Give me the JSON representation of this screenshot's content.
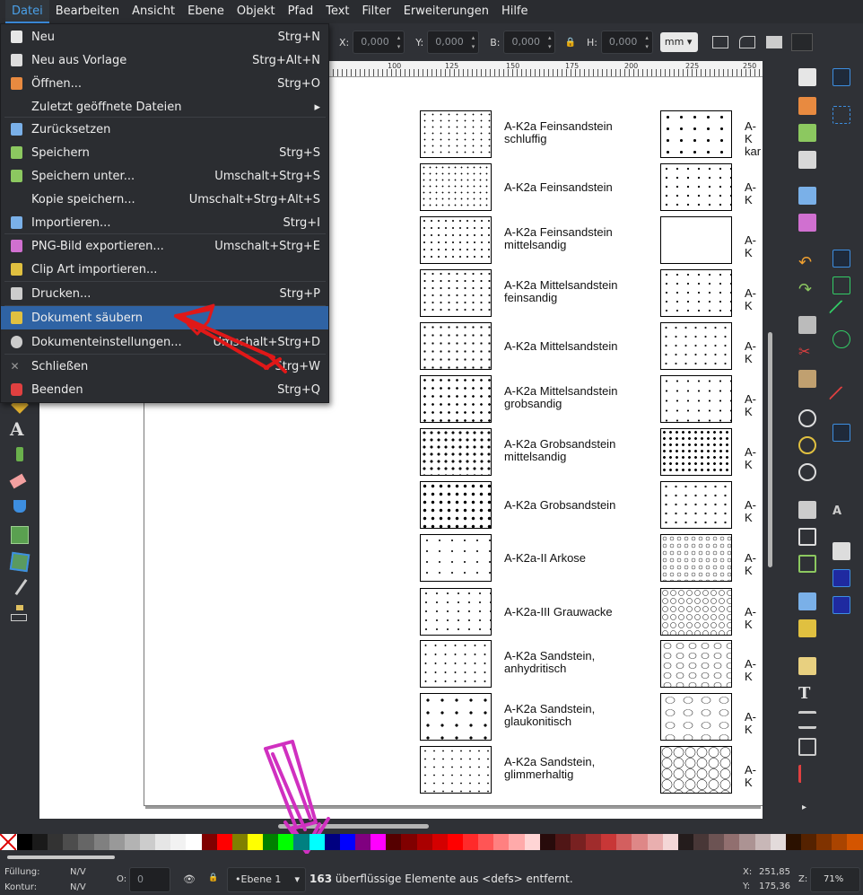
{
  "menubar": {
    "items": [
      "Datei",
      "Bearbeiten",
      "Ansicht",
      "Ebene",
      "Objekt",
      "Pfad",
      "Text",
      "Filter",
      "Erweiterungen",
      "Hilfe"
    ]
  },
  "toolbar": {
    "x_label": "X:",
    "x_value": "0,000",
    "y_label": "Y:",
    "y_value": "0,000",
    "w_label": "B:",
    "w_value": "0,000",
    "h_label": "H:",
    "h_value": "0,000",
    "unit": "mm"
  },
  "ruler": {
    "labels": [
      "100",
      "125",
      "150",
      "175",
      "200",
      "225",
      "250"
    ]
  },
  "file_menu": {
    "items": [
      {
        "label": "Neu",
        "shortcut": "Strg+N",
        "icon": "new-doc-icon"
      },
      {
        "label": "Neu aus Vorlage",
        "shortcut": "Strg+Alt+N",
        "icon": "template-icon"
      },
      {
        "label": "Öffnen...",
        "shortcut": "Strg+O",
        "icon": "open-folder-icon"
      },
      {
        "label": "Zuletzt geöffnete Dateien",
        "shortcut": "",
        "icon": "",
        "submenu": "▸"
      },
      {
        "label": "Zurücksetzen",
        "shortcut": "",
        "icon": "revert-icon"
      },
      {
        "label": "Speichern",
        "shortcut": "Strg+S",
        "icon": "save-icon"
      },
      {
        "label": "Speichern unter...",
        "shortcut": "Umschalt+Strg+S",
        "icon": "save-as-icon"
      },
      {
        "label": "Kopie speichern...",
        "shortcut": "Umschalt+Strg+Alt+S",
        "icon": ""
      },
      {
        "label": "Importieren...",
        "shortcut": "Strg+I",
        "icon": "import-icon"
      },
      {
        "label": "PNG-Bild exportieren...",
        "shortcut": "Umschalt+Strg+E",
        "icon": "export-png-icon"
      },
      {
        "label": "Clip Art importieren...",
        "shortcut": "",
        "icon": "clipart-icon"
      },
      {
        "label": "Drucken...",
        "shortcut": "Strg+P",
        "icon": "print-icon"
      },
      {
        "label": "Dokument säubern",
        "shortcut": "",
        "icon": "cleanup-icon",
        "selected": true
      },
      {
        "label": "Dokumenteinstellungen...",
        "shortcut": "Umschalt+Strg+D",
        "icon": "gear-icon"
      },
      {
        "label": "Schließen",
        "shortcut": "Strg+W",
        "icon": "close-icon"
      },
      {
        "label": "Beenden",
        "shortcut": "Strg+Q",
        "icon": "quit-icon"
      }
    ]
  },
  "patterns_left": [
    {
      "label": "A-K2a Feinsandstein\nschluffig"
    },
    {
      "label": "A-K2a Feinsandstein"
    },
    {
      "label": "A-K2a Feinsandstein\nmittelsandig"
    },
    {
      "label": "A-K2a Mittelsandstein\nfeinsandig"
    },
    {
      "label": "A-K2a Mittelsandstein"
    },
    {
      "label": "A-K2a Mittelsandstein\ngrobsandig"
    },
    {
      "label": "A-K2a Grobsandstein\nmittelsandig"
    },
    {
      "label": "A-K2a Grobsandstein"
    },
    {
      "label": "A-K2a-II Arkose"
    },
    {
      "label": "A-K2a-III Grauwacke"
    },
    {
      "label": "A-K2a Sandstein,\nanhydritisch"
    },
    {
      "label": "A-K2a Sandstein,\nglaukonitisch"
    },
    {
      "label": "A-K2a Sandstein,\nglimmerhaltig"
    }
  ],
  "patterns_right": [
    {
      "label": "A-K\nkar"
    },
    {
      "label": "A-K"
    },
    {
      "label": "A-K"
    },
    {
      "label": "A-K"
    },
    {
      "label": "A-K"
    },
    {
      "label": "A-K"
    },
    {
      "label": "A-K"
    },
    {
      "label": "A-K"
    },
    {
      "label": "A-K"
    },
    {
      "label": "A-K"
    },
    {
      "label": "A-K"
    },
    {
      "label": "A-K"
    },
    {
      "label": "A-K"
    }
  ],
  "status": {
    "fill_label": "Füllung:",
    "fill_value": "N/V",
    "stroke_label": "Kontur:",
    "stroke_value": "N/V",
    "opacity_label": "O:",
    "opacity_value": "0",
    "layer": "•Ebene 1",
    "message_count": "163",
    "message": " überflüssige Elemente aus <defs> entfernt.",
    "x_label": "X:",
    "x_value": "251,85",
    "y_label": "Y:",
    "y_value": "175,36",
    "zoom_label": "Z:",
    "zoom_value": "71%"
  },
  "palette_colors": [
    "#000000",
    "#1a1a1a",
    "#333333",
    "#4d4d4d",
    "#666666",
    "#808080",
    "#999999",
    "#b3b3b3",
    "#cccccc",
    "#e6e6e6",
    "#f2f2f2",
    "#ffffff",
    "#800000",
    "#ff0000",
    "#808000",
    "#ffff00",
    "#008000",
    "#00ff00",
    "#008080",
    "#00ffff",
    "#000080",
    "#0000ff",
    "#800080",
    "#ff00ff",
    "#550000",
    "#800000",
    "#aa0000",
    "#d40000",
    "#ff0000",
    "#ff2a2a",
    "#ff5555",
    "#ff8080",
    "#ffaaaa",
    "#ffd5d5",
    "#280b0b",
    "#501616",
    "#782121",
    "#a02c2c",
    "#c83737",
    "#d35f5f",
    "#de8787",
    "#e9afaf",
    "#f4d7d7",
    "#241c1c",
    "#483737",
    "#6c5353",
    "#916f6f",
    "#ac9393",
    "#c8b7b7",
    "#e3dbdb",
    "#2b1100",
    "#552200",
    "#803300",
    "#aa4400",
    "#d45500"
  ]
}
